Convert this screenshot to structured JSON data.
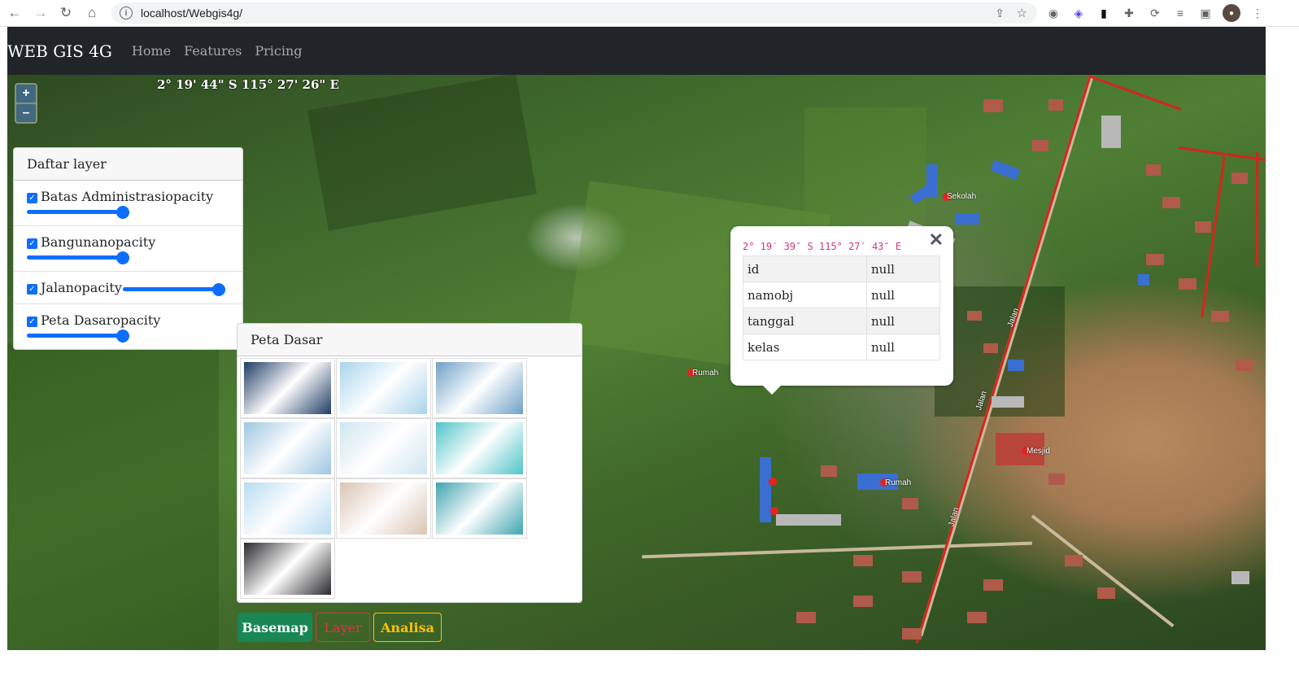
{
  "browser": {
    "url": "localhost/Webgis4g/",
    "back_icon": "arrow-left-icon",
    "forward_icon": "arrow-right-icon",
    "reload_icon": "reload-icon",
    "home_icon": "home-icon"
  },
  "navbar": {
    "brand": "WEB GIS 4G",
    "links": [
      "Home",
      "Features",
      "Pricing"
    ]
  },
  "map": {
    "coordinate_readout": "2° 19' 44\" S 115° 27' 26\" E",
    "zoom_in": "+",
    "zoom_out": "–",
    "markers": [
      {
        "label": "Sekolah"
      },
      {
        "label": "Rumah"
      },
      {
        "label": "Mesjid"
      },
      {
        "label": "Rumah"
      }
    ],
    "road_labels": [
      "Jalan",
      "Jalan",
      "Jalan"
    ]
  },
  "layer_panel": {
    "title": "Daftar layer",
    "layers": [
      {
        "label": "Batas Administrasiopacity",
        "checked": true,
        "opacity": 0.9
      },
      {
        "label": "Bangunanopacity",
        "checked": true,
        "opacity": 0.9
      },
      {
        "label": "Jalanopacity",
        "checked": true,
        "opacity": 0.9
      },
      {
        "label": "Peta Dasaropacity",
        "checked": true,
        "opacity": 0.9
      }
    ]
  },
  "basemap_panel": {
    "title": "Peta Dasar",
    "options": [
      {
        "name": "satellite-dark",
        "color": "#1e3c64"
      },
      {
        "name": "light-street",
        "color": "#a8d4ec"
      },
      {
        "name": "topographic",
        "color": "#6fa0c8"
      },
      {
        "name": "world-street",
        "color": "#9ec6e2"
      },
      {
        "name": "terrain-light",
        "color": "#cfe5ef"
      },
      {
        "name": "ocean",
        "color": "#4fc4c8"
      },
      {
        "name": "light-gray",
        "color": "#b8dcf0"
      },
      {
        "name": "national-geographic",
        "color": "#d9c4b4"
      },
      {
        "name": "bathymetry",
        "color": "#3fa4b0"
      },
      {
        "name": "dark-gray",
        "color": "#2a2a2e"
      }
    ]
  },
  "popup": {
    "close": "✕",
    "coordinate": "2° 19′ 39″ S 115° 27′ 43″ E",
    "rows": [
      {
        "key": "id",
        "value": "null"
      },
      {
        "key": "namobj",
        "value": "null"
      },
      {
        "key": "tanggal",
        "value": "null"
      },
      {
        "key": "kelas",
        "value": "null"
      }
    ]
  },
  "buttons": {
    "basemap": "Basemap",
    "layer": "Layer",
    "analisa": "Analisa"
  },
  "colors": {
    "navbar": "#212529",
    "primary": "#0d6efd",
    "success": "#198754",
    "danger": "#dc3545",
    "warning": "#ffc107"
  }
}
